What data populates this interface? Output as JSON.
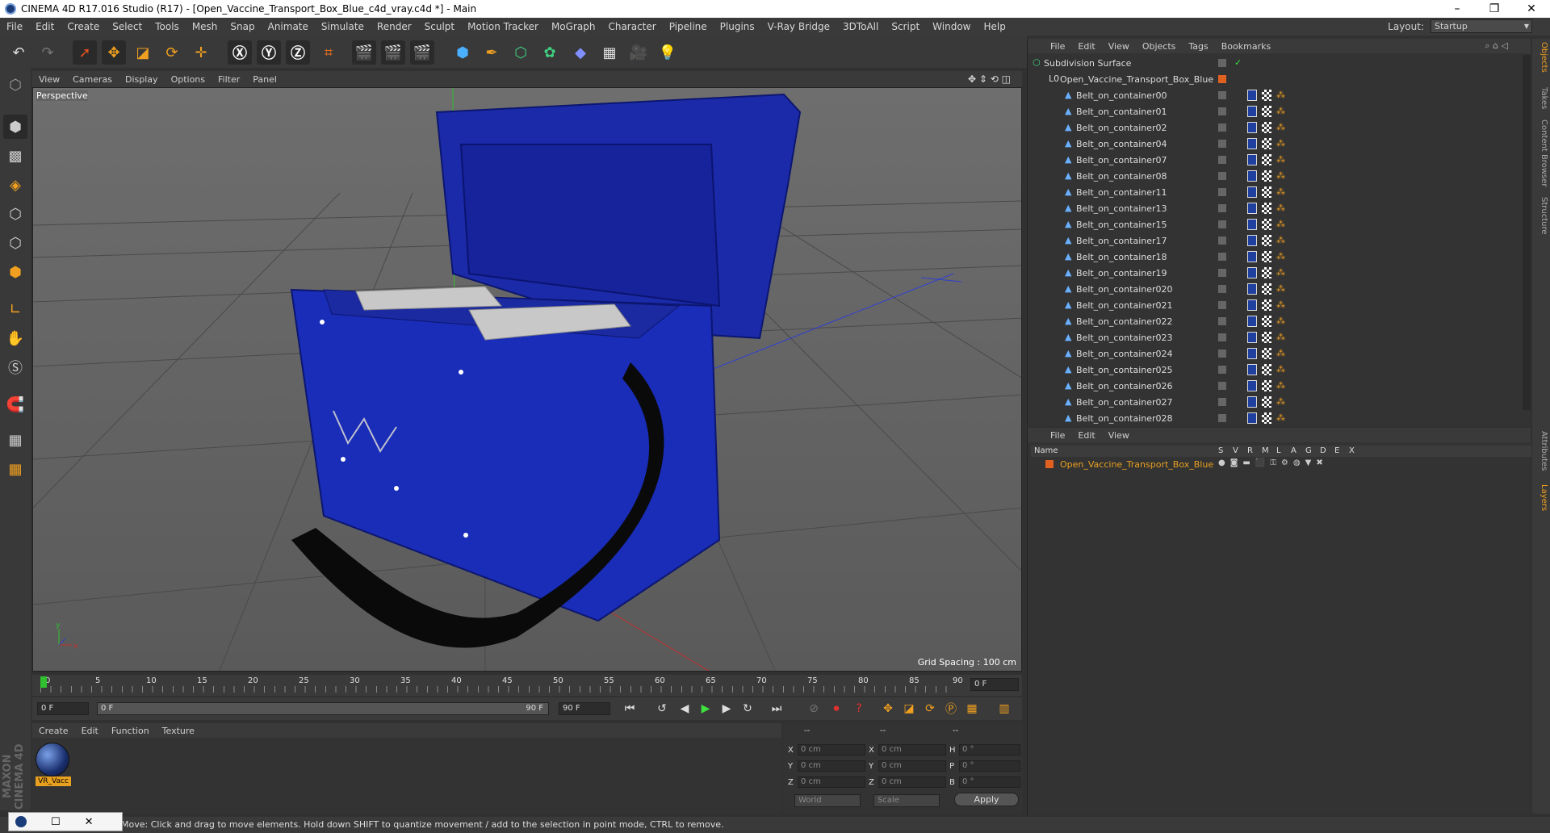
{
  "window": {
    "title": "CINEMA 4D R17.016 Studio (R17) - [Open_Vaccine_Transport_Box_Blue_c4d_vray.c4d *] - Main",
    "controls": [
      "–",
      "❐",
      "✕"
    ]
  },
  "menu": [
    "File",
    "Edit",
    "Create",
    "Select",
    "Tools",
    "Mesh",
    "Snap",
    "Animate",
    "Simulate",
    "Render",
    "Sculpt",
    "Motion Tracker",
    "MoGraph",
    "Character",
    "Pipeline",
    "Plugins",
    "V-Ray Bridge",
    "3DToAll",
    "Script",
    "Window",
    "Help"
  ],
  "layout": {
    "label": "Layout:",
    "value": "Startup"
  },
  "viewport": {
    "menu": [
      "View",
      "Cameras",
      "Display",
      "Options",
      "Filter",
      "Panel"
    ],
    "label": "Perspective",
    "grid_spacing": "Grid Spacing : 100 cm"
  },
  "timeline": {
    "ticks": [
      "0",
      "5",
      "10",
      "15",
      "20",
      "25",
      "30",
      "35",
      "40",
      "45",
      "50",
      "55",
      "60",
      "65",
      "70",
      "75",
      "80",
      "85",
      "90"
    ],
    "current_frame": "0 F"
  },
  "transport": {
    "start": "0 F",
    "slider_start": "0 F",
    "slider_end": "90 F",
    "end": "90 F"
  },
  "materials": {
    "menu": [
      "Create",
      "Edit",
      "Function",
      "Texture"
    ],
    "items": [
      {
        "name": "VR_Vacc"
      }
    ]
  },
  "coordinates": {
    "headers": [
      "--",
      "--",
      "--"
    ],
    "rows": [
      {
        "a": "X",
        "av": "0 cm",
        "b": "X",
        "bv": "0 cm",
        "c": "H",
        "cv": "0 °"
      },
      {
        "a": "Y",
        "av": "0 cm",
        "b": "Y",
        "bv": "0 cm",
        "c": "P",
        "cv": "0 °"
      },
      {
        "a": "Z",
        "av": "0 cm",
        "b": "Z",
        "bv": "0 cm",
        "c": "B",
        "cv": "0 °"
      }
    ],
    "mode": "World",
    "scale": "Scale",
    "apply": "Apply"
  },
  "objects": {
    "menu": [
      "File",
      "Edit",
      "View",
      "Objects",
      "Tags",
      "Bookmarks"
    ],
    "items": [
      "Subdivision Surface",
      "Open_Vaccine_Transport_Box_Blue",
      "Belt_on_container00",
      "Belt_on_container01",
      "Belt_on_container02",
      "Belt_on_container04",
      "Belt_on_container07",
      "Belt_on_container08",
      "Belt_on_container11",
      "Belt_on_container13",
      "Belt_on_container15",
      "Belt_on_container17",
      "Belt_on_container18",
      "Belt_on_container19",
      "Belt_on_container020",
      "Belt_on_container021",
      "Belt_on_container022",
      "Belt_on_container023",
      "Belt_on_container024",
      "Belt_on_container025",
      "Belt_on_container026",
      "Belt_on_container027",
      "Belt_on_container028"
    ]
  },
  "layers": {
    "menu": [
      "File",
      "Edit",
      "View"
    ],
    "columns": [
      "Name",
      "S",
      "V",
      "R",
      "M",
      "L",
      "A",
      "G",
      "D",
      "E",
      "X"
    ],
    "row": "Open_Vaccine_Transport_Box_Blue"
  },
  "side_tabs": [
    "Objects",
    "Takes",
    "Content Browser",
    "Structure",
    "Attributes",
    "Layers"
  ],
  "status": "Move: Click and drag to move elements. Hold down SHIFT to quantize movement / add to the selection in point mode, CTRL to remove.",
  "brand": "MAXON CINEMA 4D",
  "colors": {
    "accent": "#e8a020",
    "object": "#1a2fb0"
  }
}
